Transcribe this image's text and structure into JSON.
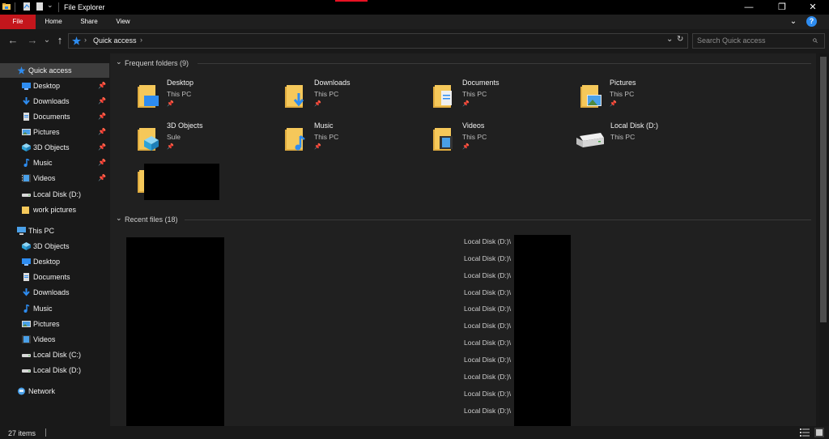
{
  "window": {
    "title": "File Explorer",
    "minimize_glyph": "—",
    "restore_glyph": "❐",
    "close_glyph": "✕"
  },
  "ribbon": {
    "tabs": [
      "File",
      "Home",
      "Share",
      "View"
    ],
    "expand_glyph": "⌄",
    "help_glyph": "?"
  },
  "address": {
    "back_glyph": "←",
    "forward_glyph": "→",
    "recent_glyph": "⌄",
    "up_glyph": "↑",
    "breadcrumb_sep": "›",
    "location": "Quick access",
    "dropdown_glyph": "⌄",
    "refresh_glyph": "↻",
    "search_placeholder": "Search Quick access",
    "search_glyph": "⌕"
  },
  "nav": {
    "quick_access": "Quick access",
    "pinned": [
      {
        "label": "Desktop",
        "icon": "desktop-icon"
      },
      {
        "label": "Downloads",
        "icon": "downloads-icon"
      },
      {
        "label": "Documents",
        "icon": "documents-icon"
      },
      {
        "label": "Pictures",
        "icon": "pictures-icon"
      },
      {
        "label": "3D Objects",
        "icon": "3d-objects-icon"
      },
      {
        "label": "Music",
        "icon": "music-icon"
      },
      {
        "label": "Videos",
        "icon": "videos-icon"
      }
    ],
    "other": [
      {
        "label": "Local Disk (D:)",
        "icon": "drive-icon"
      },
      {
        "label": "work pictures",
        "icon": "folder-icon"
      }
    ],
    "this_pc": "This PC",
    "this_pc_items": [
      {
        "label": "3D Objects",
        "icon": "3d-objects-icon"
      },
      {
        "label": "Desktop",
        "icon": "desktop-icon"
      },
      {
        "label": "Documents",
        "icon": "documents-icon"
      },
      {
        "label": "Downloads",
        "icon": "downloads-icon"
      },
      {
        "label": "Music",
        "icon": "music-icon"
      },
      {
        "label": "Pictures",
        "icon": "pictures-icon"
      },
      {
        "label": "Videos",
        "icon": "videos-icon"
      },
      {
        "label": "Local Disk (C:)",
        "icon": "drive-icon"
      },
      {
        "label": "Local Disk (D:)",
        "icon": "drive-icon"
      }
    ],
    "network": "Network",
    "pin_glyph": "📌"
  },
  "content": {
    "frequent_header": "Frequent folders (9)",
    "recent_header": "Recent files (18)",
    "group_toggle_glyph": "⌄",
    "folders": [
      {
        "name": "Desktop",
        "sub": "This PC",
        "pinned": true,
        "icon": "desktop-folder-icon"
      },
      {
        "name": "Downloads",
        "sub": "This PC",
        "pinned": true,
        "icon": "downloads-folder-icon"
      },
      {
        "name": "Documents",
        "sub": "This PC",
        "pinned": true,
        "icon": "documents-folder-icon"
      },
      {
        "name": "Pictures",
        "sub": "This PC",
        "pinned": true,
        "icon": "pictures-folder-icon"
      },
      {
        "name": "3D Objects",
        "sub": "Sule",
        "pinned": true,
        "icon": "3d-objects-folder-icon"
      },
      {
        "name": "Music",
        "sub": "This PC",
        "pinned": true,
        "icon": "music-folder-icon"
      },
      {
        "name": "Videos",
        "sub": "This PC",
        "pinned": true,
        "icon": "videos-folder-icon"
      },
      {
        "name": "Local Disk (D:)",
        "sub": "This PC",
        "pinned": false,
        "icon": "local-disk-icon"
      }
    ],
    "recent_paths": [
      "Local Disk (D:)\\",
      "Local Disk (D:)\\",
      "Local Disk (D:)\\",
      "Local Disk (D:)\\",
      "Local Disk (D:)\\",
      "Local Disk (D:)\\",
      "Local Disk (D:)\\",
      "Local Disk (D:)\\",
      "Local Disk (D:)\\",
      "Local Disk (D:)\\",
      "Local Disk (D:)\\"
    ]
  },
  "status": {
    "item_count": "27 items"
  },
  "colors": {
    "accent_file_tab": "#c4161c",
    "folder_yellow": "#f5c85a",
    "icon_blue": "#2e8cf0"
  }
}
